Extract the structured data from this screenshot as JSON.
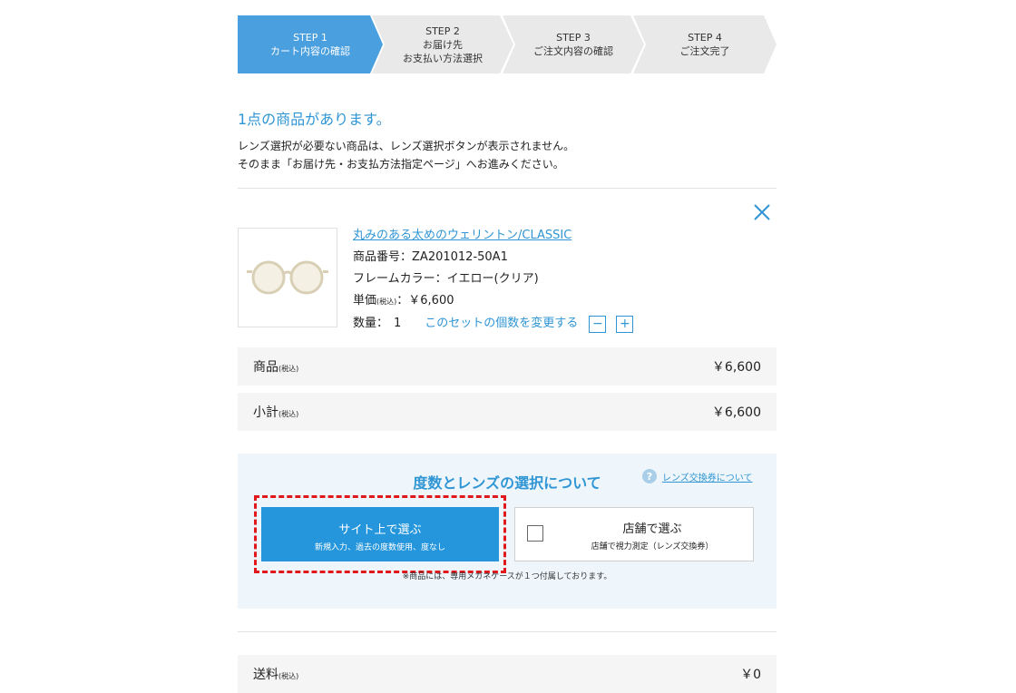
{
  "steps": [
    {
      "line1": "STEP 1",
      "line2": "カート内容の確認",
      "line3": "",
      "active": true
    },
    {
      "line1": "STEP 2",
      "line2": "お届け先",
      "line3": "お支払い方法選択",
      "active": false
    },
    {
      "line1": "STEP 3",
      "line2": "ご注文内容の確認",
      "line3": "",
      "active": false
    },
    {
      "line1": "STEP 4",
      "line2": "ご注文完了",
      "line3": "",
      "active": false
    }
  ],
  "headline": "1点の商品があります。",
  "note": {
    "line1": "レンズ選択が必要ない商品は、レンズ選択ボタンが表示されません。",
    "line2": "そのまま「お届け先・お支払方法指定ページ」へお進みください。"
  },
  "product": {
    "name": "丸みのある太めのウェリントン/CLASSIC",
    "code_label": "商品番号：",
    "code": "ZA201012-50A1",
    "color_label": "フレームカラー：",
    "color": "イエロー(クリア)",
    "price_label": "単価",
    "tax_label": "(税込)",
    "price_sep": "：",
    "price": "￥6,600",
    "qty_label": "数量：",
    "qty": "1",
    "qty_change": "このセットの個数を変更する",
    "minus": "−",
    "plus": "+"
  },
  "summary": {
    "items_label": "商品",
    "items_tax": "(税込)",
    "items_value": "￥6,600",
    "subtotal_label": "小計",
    "subtotal_tax": "(税込)",
    "subtotal_value": "￥6,600"
  },
  "lens": {
    "title": "度数とレンズの選択について",
    "help_icon": "?",
    "help_label": "レンズ交換券について",
    "site_title": "サイト上で選ぶ",
    "site_sub": "新規入力、過去の度数使用、度なし",
    "store_title": "店舗で選ぶ",
    "store_sub": "店舗で視力測定（レンズ交換券）",
    "case_note": "※商品には、専用メガネケースが１つ付属しております。"
  },
  "shipping": {
    "label": "送料",
    "tax": "(税込)",
    "value": "￥0"
  },
  "colors": {
    "accent": "#2f95d4",
    "step_active": "#4a9fdf",
    "step_inactive": "#e9e9e9",
    "highlight": "#e0181b",
    "button": "#2596dc"
  }
}
